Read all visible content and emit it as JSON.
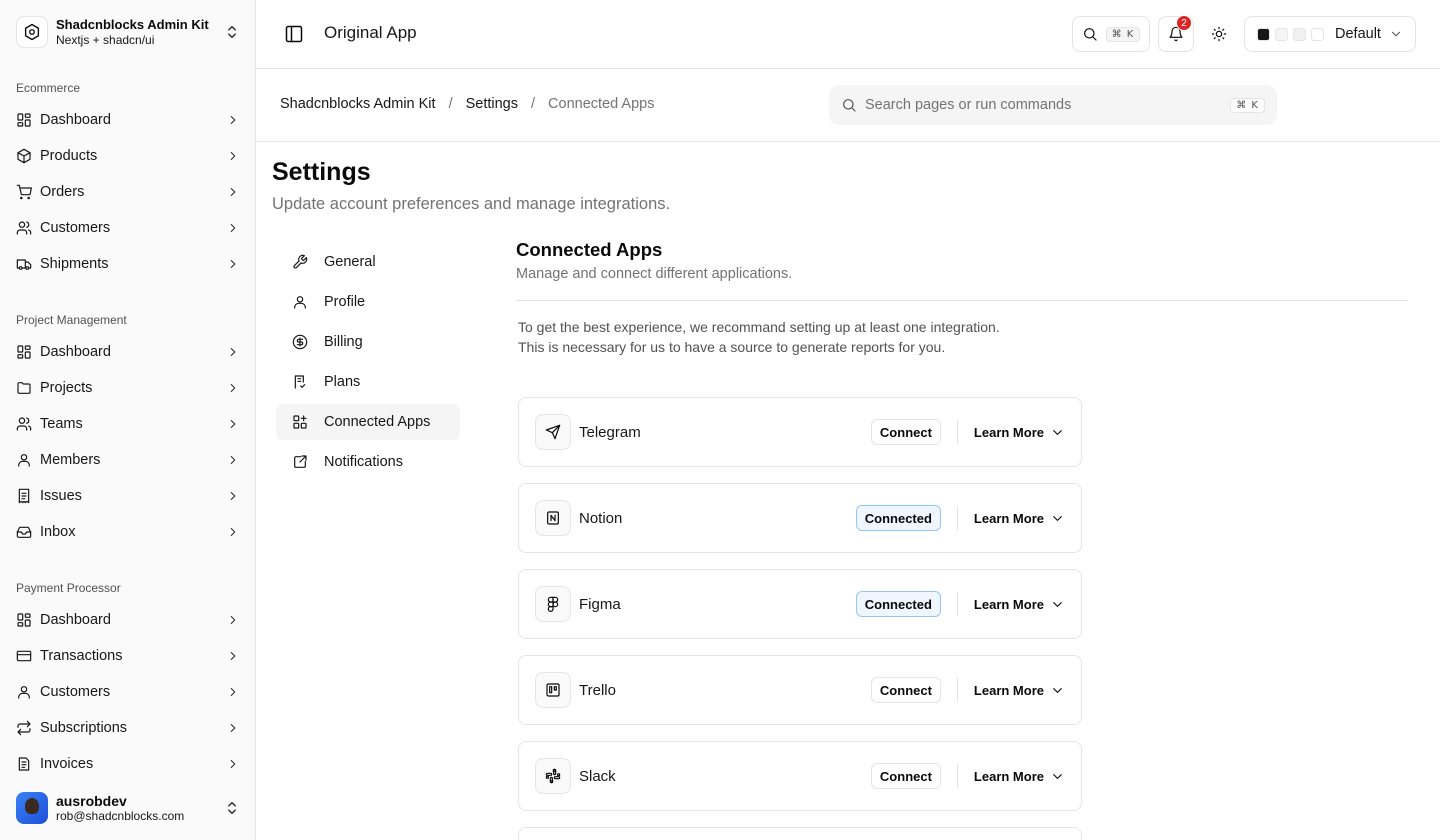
{
  "team": {
    "name": "Shadcnblocks Admin Kit",
    "subtitle": "Nextjs + shadcn/ui"
  },
  "sidebar": {
    "groups": [
      {
        "label": "Ecommerce",
        "items": [
          {
            "label": "Dashboard",
            "icon": "dashboard-icon"
          },
          {
            "label": "Products",
            "icon": "package-icon"
          },
          {
            "label": "Orders",
            "icon": "cart-icon"
          },
          {
            "label": "Customers",
            "icon": "users-icon"
          },
          {
            "label": "Shipments",
            "icon": "truck-icon"
          }
        ]
      },
      {
        "label": "Project Management",
        "items": [
          {
            "label": "Dashboard",
            "icon": "dashboard-icon"
          },
          {
            "label": "Projects",
            "icon": "folder-icon"
          },
          {
            "label": "Teams",
            "icon": "users-icon"
          },
          {
            "label": "Members",
            "icon": "user-icon"
          },
          {
            "label": "Issues",
            "icon": "receipt-icon"
          },
          {
            "label": "Inbox",
            "icon": "inbox-icon"
          }
        ]
      },
      {
        "label": "Payment Processor",
        "items": [
          {
            "label": "Dashboard",
            "icon": "dashboard-icon"
          },
          {
            "label": "Transactions",
            "icon": "card-icon"
          },
          {
            "label": "Customers",
            "icon": "user-icon"
          },
          {
            "label": "Subscriptions",
            "icon": "repeat-icon"
          },
          {
            "label": "Invoices",
            "icon": "file-icon"
          }
        ]
      }
    ]
  },
  "user": {
    "name": "ausrobdev",
    "email": "rob@shadcnblocks.com"
  },
  "header": {
    "app_title": "Original App",
    "search_shortcut": "⌘ K",
    "notification_count": "2",
    "theme_label": "Default",
    "theme_swatches": [
      "#171717",
      "#f5f5f5",
      "#f0f0f0",
      "#ffffff"
    ]
  },
  "breadcrumb": {
    "items": [
      "Shadcnblocks Admin Kit",
      "Settings",
      "Connected Apps"
    ],
    "separator": "/"
  },
  "command_search": {
    "placeholder": "Search pages or run commands",
    "shortcut": "⌘ K"
  },
  "page": {
    "title": "Settings",
    "description": "Update account preferences and manage integrations."
  },
  "settings_nav": [
    {
      "label": "General",
      "icon": "wrench-icon"
    },
    {
      "label": "Profile",
      "icon": "user-icon"
    },
    {
      "label": "Billing",
      "icon": "dollar-icon"
    },
    {
      "label": "Plans",
      "icon": "receipt-check-icon"
    },
    {
      "label": "Connected Apps",
      "icon": "apps-icon",
      "active": true
    },
    {
      "label": "Notifications",
      "icon": "bell-external-icon"
    }
  ],
  "connected_apps": {
    "title": "Connected Apps",
    "description": "Manage and connect different applications.",
    "intro_line1": "To get the best experience, we recommand setting up at least one integration.",
    "intro_line2": "This is necessary for us to have a source to generate reports for you.",
    "learn_more_label": "Learn More",
    "apps": [
      {
        "name": "Telegram",
        "status": "Connect",
        "connected": false,
        "icon": "telegram-icon"
      },
      {
        "name": "Notion",
        "status": "Connected",
        "connected": true,
        "icon": "notion-icon"
      },
      {
        "name": "Figma",
        "status": "Connected",
        "connected": true,
        "icon": "figma-icon"
      },
      {
        "name": "Trello",
        "status": "Connect",
        "connected": false,
        "icon": "trello-icon"
      },
      {
        "name": "Slack",
        "status": "Connect",
        "connected": false,
        "icon": "slack-icon"
      }
    ]
  }
}
